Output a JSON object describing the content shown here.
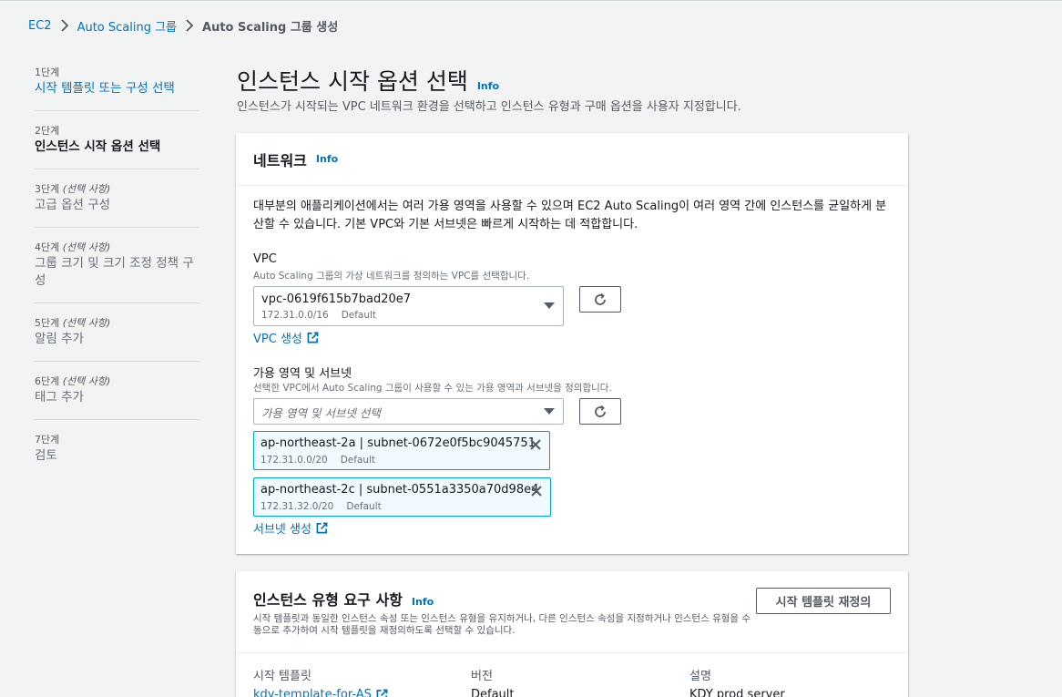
{
  "breadcrumb": {
    "items": [
      "EC2",
      "Auto Scaling 그룹",
      "Auto Scaling 그룹 생성"
    ]
  },
  "wizard": {
    "steps": [
      {
        "label": "1단계",
        "optional": "",
        "title": "시작 템플릿 또는 구성 선택",
        "state": "link"
      },
      {
        "label": "2단계",
        "optional": "",
        "title": "인스턴스 시작 옵션 선택",
        "state": "current"
      },
      {
        "label": "3단계",
        "optional": "(선택 사항)",
        "title": "고급 옵션 구성",
        "state": "disabled"
      },
      {
        "label": "4단계",
        "optional": "(선택 사항)",
        "title": "그룹 크기 및 크기 조정 정책 구성",
        "state": "disabled"
      },
      {
        "label": "5단계",
        "optional": "(선택 사항)",
        "title": "알림 추가",
        "state": "disabled"
      },
      {
        "label": "6단계",
        "optional": "(선택 사항)",
        "title": "태그 추가",
        "state": "disabled"
      },
      {
        "label": "7단계",
        "optional": "",
        "title": "검토",
        "state": "disabled"
      }
    ]
  },
  "page": {
    "title": "인스턴스 시작 옵션 선택",
    "info": "Info",
    "description": "인스턴스가 시작되는 VPC 네트워크 환경을 선택하고 인스턴스 유형과 구매 옵션을 사용자 지정합니다."
  },
  "network": {
    "title": "네트워크",
    "info": "Info",
    "description": "대부분의 애플리케이션에서는 여러 가용 영역을 사용할 수 있으며 EC2 Auto Scaling이 여러 영역 간에 인스턴스를 균일하게 분산할 수 있습니다. 기본 VPC와 기본 서브넷은 빠르게 시작하는 데 적합합니다.",
    "vpc_label": "VPC",
    "vpc_hint": "Auto Scaling 그룹의 가상 네트워크를 정의하는 VPC를 선택합니다.",
    "vpc_value": "vpc-0619f615b7bad20e7",
    "vpc_cidr": "172.31.0.0/16",
    "vpc_tag": "Default",
    "create_vpc": "VPC 생성",
    "az_label": "가용 영역 및 서브넷",
    "az_hint": "선택한 VPC에서 Auto Scaling 그룹이 사용할 수 있는 가용 영역과 서브넷을 정의합니다.",
    "az_placeholder": "가용 영역 및 서브넷 선택",
    "subnets": [
      {
        "name": "ap-northeast-2a | subnet-0672e0f5bc9045751",
        "cidr": "172.31.0.0/20",
        "tag": "Default"
      },
      {
        "name": "ap-northeast-2c | subnet-0551a3350a70d98e4",
        "cidr": "172.31.32.0/20",
        "tag": "Default"
      }
    ],
    "create_subnet": "서브넷 생성"
  },
  "instance": {
    "title": "인스턴스 유형 요구 사항",
    "info": "Info",
    "description": "시작 템플릿과 동일한 인스턴스 속성 또는 인스턴스 유형을 유지하거나, 다른 인스턴스 속성을 지정하거나 인스턴스 유형을 수동으로 추가하여 시작 템플릿을 재정의하도록 선택할 수 있습니다.",
    "override_button": "시작 템플릿 재정의",
    "template_key": "시작 템플릿",
    "template_value": "kdy-template-for-AS",
    "version_key": "버전",
    "version_value": "Default",
    "desc_key": "설명",
    "desc_value": "KDY prod server"
  },
  "colors": {
    "link": "#0073bb",
    "token_bg": "#f1faff",
    "token_border": "#00a1c9",
    "page_bg": "#f2f3f3"
  }
}
